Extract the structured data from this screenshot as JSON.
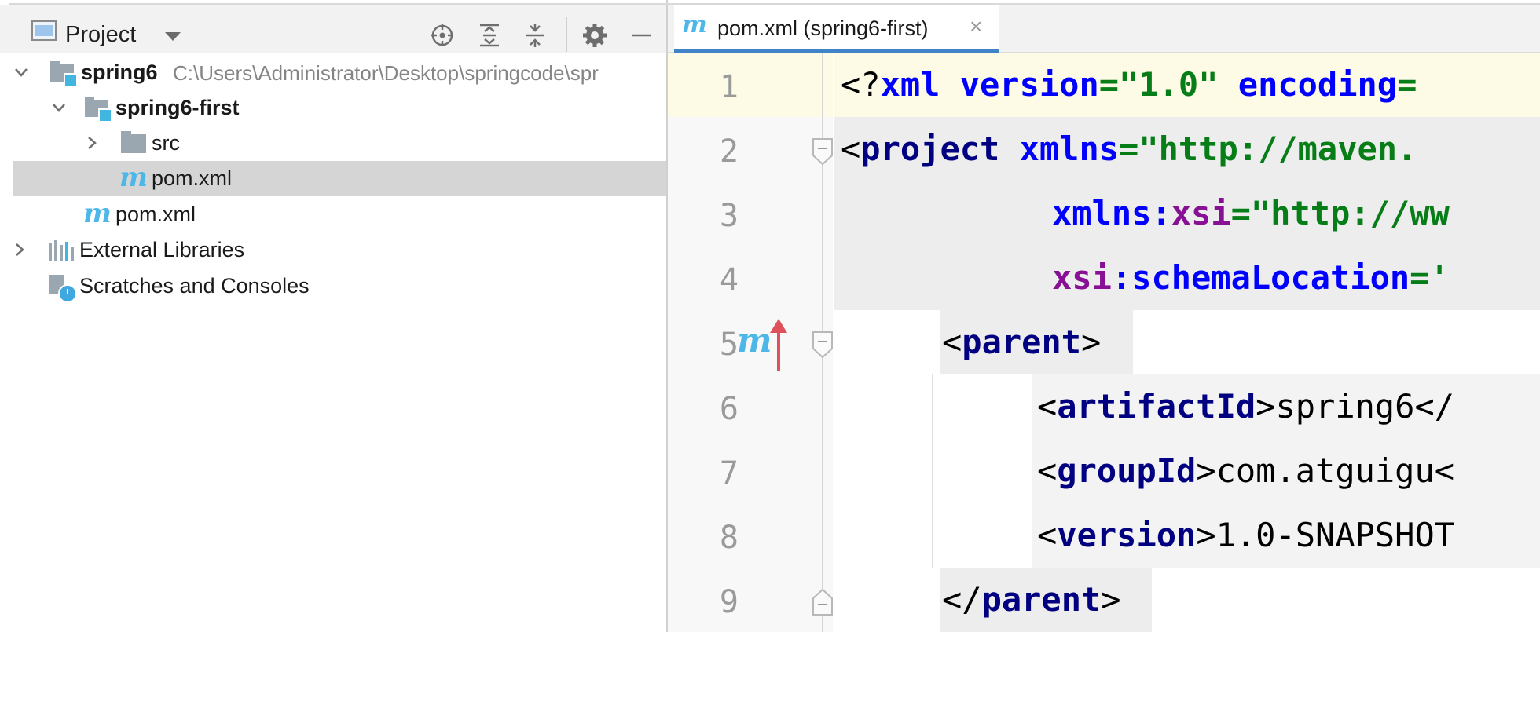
{
  "project_panel": {
    "title": "Project",
    "tree": [
      {
        "label": "spring6",
        "path": "C:\\Users\\Administrator\\Desktop\\springcode\\spr"
      },
      {
        "label": "spring6-first"
      },
      {
        "label": "src"
      },
      {
        "label": "pom.xml",
        "selected": true
      },
      {
        "label": "pom.xml"
      },
      {
        "label": "External Libraries"
      },
      {
        "label": "Scratches and Consoles"
      }
    ]
  },
  "editor": {
    "tab": {
      "icon": "m",
      "label": "pom.xml (spring6-first)",
      "close": "×"
    },
    "gutter_maven_icon": "m",
    "line_numbers": [
      "1",
      "2",
      "3",
      "4",
      "5",
      "6",
      "7",
      "8",
      "9"
    ],
    "code": {
      "l1": {
        "p1": "<?",
        "p2": "xml ",
        "p3": "version",
        "p4": "=",
        "p5": "\"1.0\"",
        "p6": " ",
        "p7": "encoding",
        "p8": "="
      },
      "l2": {
        "p1": "<",
        "p2": "project ",
        "p3": "xmlns",
        "p4": "=",
        "p5": "\"http://maven."
      },
      "l3": {
        "p1": "xmlns",
        "p2": ":",
        "p3": "xsi",
        "p4": "=",
        "p5": "\"http://ww"
      },
      "l4": {
        "p1": "xsi",
        "p2": ":",
        "p3": "schemaLocation",
        "p4": "=",
        "p5": "'"
      },
      "l5": {
        "p1": "<",
        "p2": "parent",
        "p3": ">"
      },
      "l6": {
        "p1": "<",
        "p2": "artifactId",
        "p3": ">",
        "p4": "spring6",
        "p5": "</"
      },
      "l7": {
        "p1": "<",
        "p2": "groupId",
        "p3": ">",
        "p4": "com.atguigu",
        "p5": "<"
      },
      "l8": {
        "p1": "<",
        "p2": "version",
        "p3": ">",
        "p4": "1.0-SNAPSHOT"
      },
      "l9": {
        "p1": "</",
        "p2": "parent",
        "p3": ">"
      }
    }
  },
  "colors": {
    "tag": "#000080",
    "attribute": "#0000ff",
    "namespace": "#871094",
    "string_value": "#067d17",
    "tab_underline": "#4083c9",
    "maven_icon": "#4db8e8",
    "selection_bg": "#d5d5d5",
    "current_line_bg": "#fdfbe6",
    "gutter_arrow": "#e0505a"
  }
}
